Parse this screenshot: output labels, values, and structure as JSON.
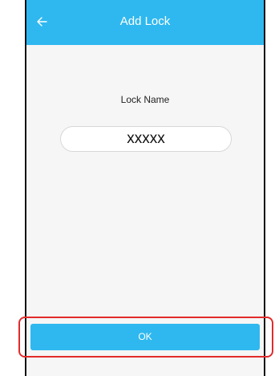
{
  "header": {
    "title": "Add Lock",
    "back_icon": "arrow-left-icon",
    "color": "#2fb8ef"
  },
  "form": {
    "lock_name_label": "Lock Name",
    "lock_name_value": "xxxxx"
  },
  "actions": {
    "ok_label": "OK",
    "highlight_color": "#e22b2b"
  }
}
